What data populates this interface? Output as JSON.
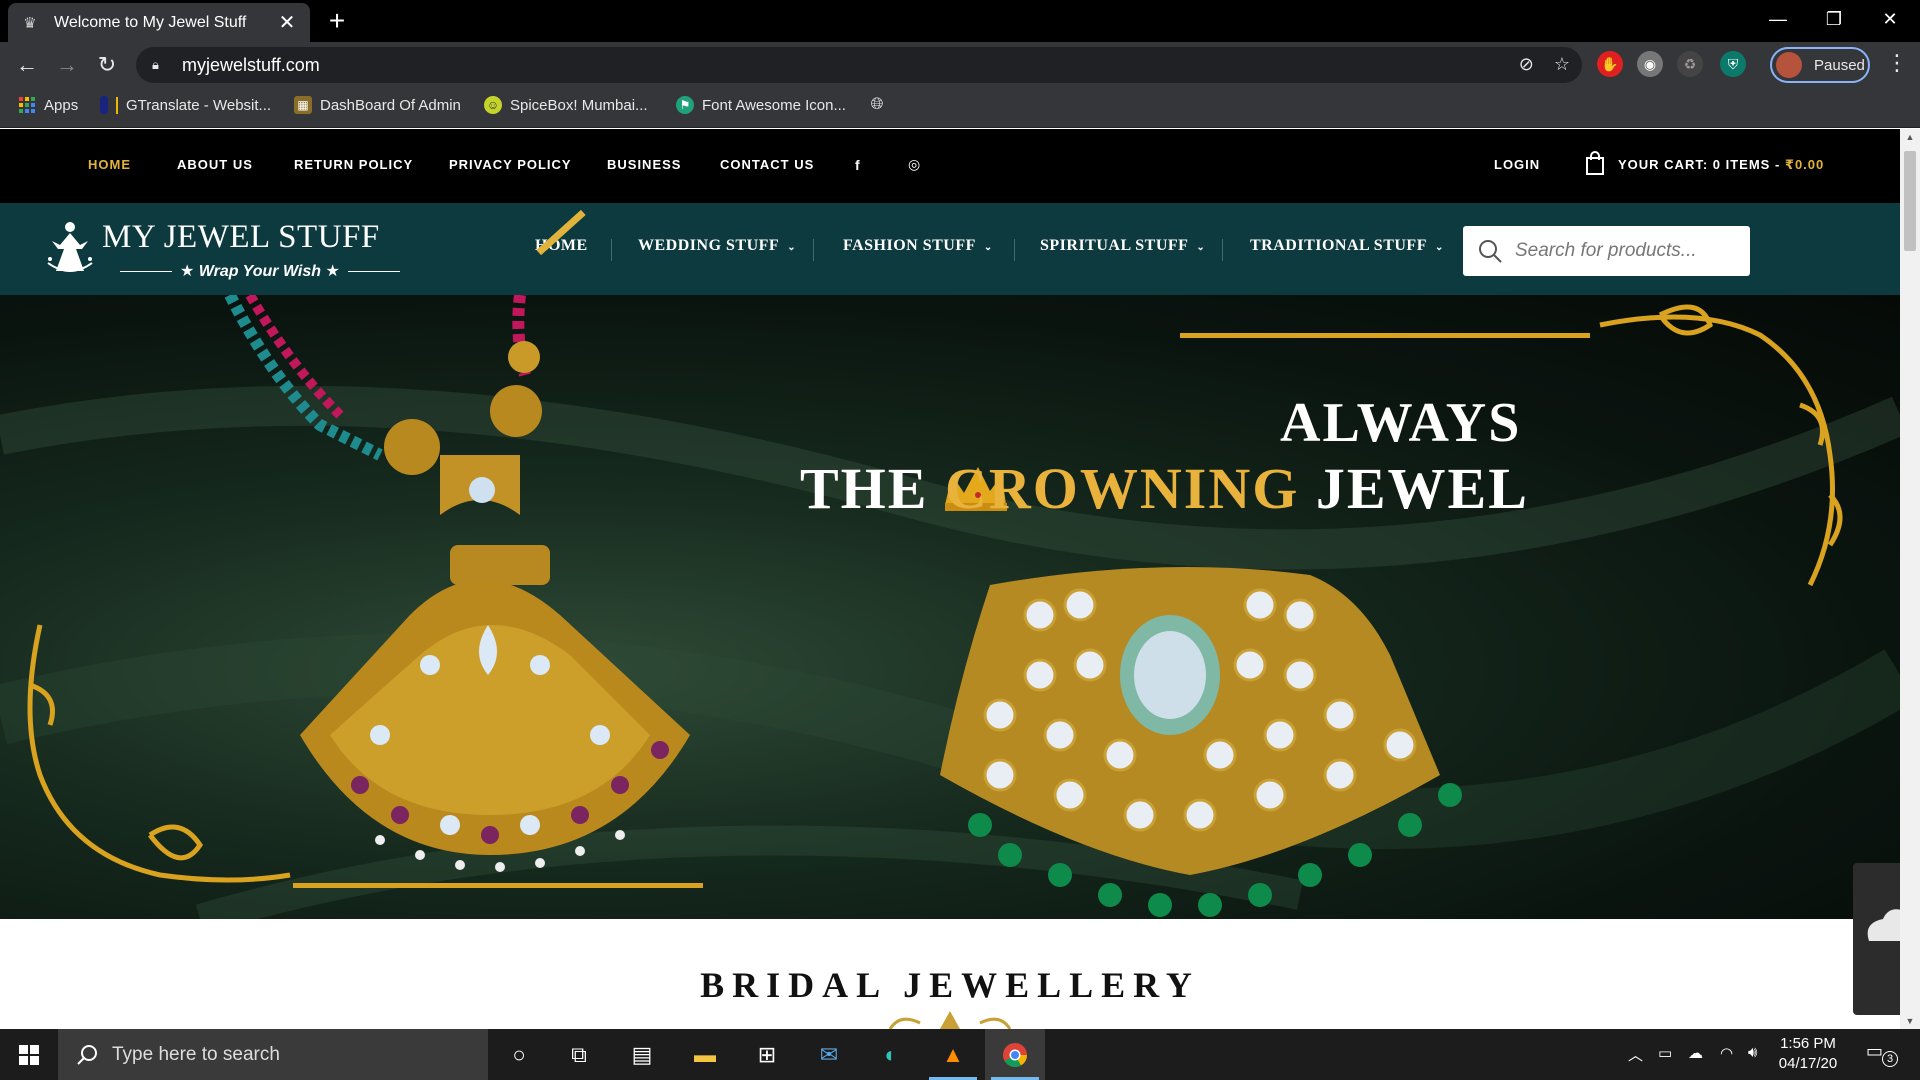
{
  "browser": {
    "tab_title": "Welcome to My Jewel Stuff",
    "tab_close": "✕",
    "new_tab": "+",
    "url": "myjewelstuff.com",
    "profile_label": "Paused",
    "window_controls": [
      "—",
      "❐",
      "✕"
    ],
    "bookmarks": [
      {
        "label": "Apps",
        "icon": "apps-grid-icon"
      },
      {
        "label": "GTranslate - Websit...",
        "icon": "gtranslate-icon"
      },
      {
        "label": "DashBoard Of Admin",
        "icon": "dashboard-icon"
      },
      {
        "label": "SpiceBox! Mumbai...",
        "icon": "spicebox-icon"
      },
      {
        "label": "Font Awesome Icon...",
        "icon": "font-awesome-icon"
      }
    ]
  },
  "topbar": {
    "links": [
      "HOME",
      "ABOUT US",
      "RETURN POLICY",
      "PRIVACY POLICY",
      "BUSINESS",
      "CONTACT US"
    ],
    "facebook": "f",
    "instagram": "◎",
    "login": "LOGIN",
    "cart": "YOUR CART: 0 ITEMS - ",
    "cart_amount": "₹0.00",
    "active_color": "#e2b33c"
  },
  "header": {
    "logo_name": "MY JEWEL STUFF",
    "logo_tagline": "★ Wrap Your Wish ★",
    "nav": [
      {
        "label": "HOME",
        "has_caret": false
      },
      {
        "label": "WEDDING STUFF",
        "has_caret": true
      },
      {
        "label": "FASHION STUFF",
        "has_caret": true
      },
      {
        "label": "SPIRITUAL STUFF",
        "has_caret": true
      },
      {
        "label": "TRADITIONAL STUFF",
        "has_caret": true
      }
    ],
    "caret": "⌄",
    "search_placeholder": "Search for products...",
    "bg_color": "#0d3a3f"
  },
  "hero": {
    "line1": "ALWAYS",
    "line2_pre": "THE ",
    "line2_gold": "CROWNING",
    "line2_post": " JEWEL",
    "gold_color": "#e8b23c"
  },
  "section": {
    "title": "BRIDAL JEWELLERY"
  },
  "taskbar": {
    "search_placeholder": "Type here to search",
    "time": "1:56 PM",
    "date": "04/17/20",
    "notification_count": "3"
  }
}
